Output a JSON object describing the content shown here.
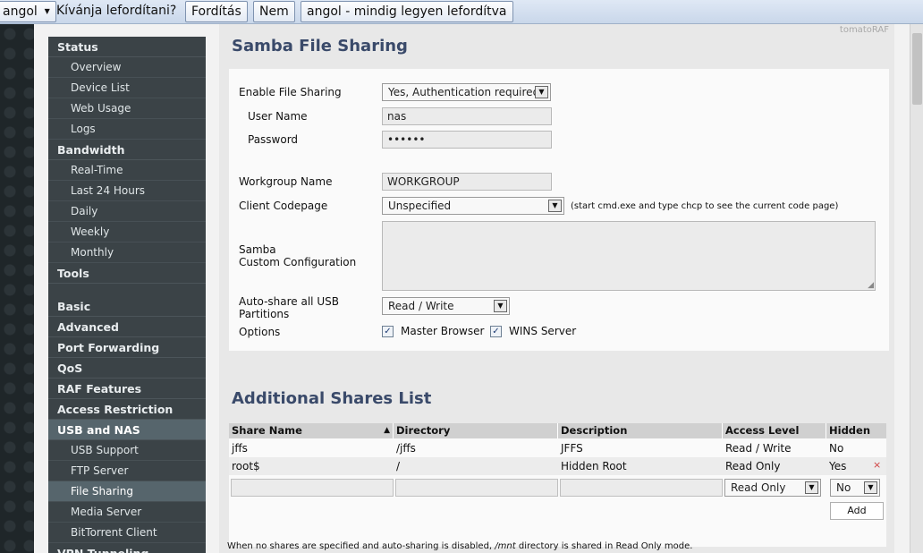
{
  "translate_bar": {
    "language": "angol",
    "question": "Kívánja lefordítani?",
    "translate": "Fordítás",
    "no": "Nem",
    "always": "angol - mindig legyen lefordítva"
  },
  "sidebar": {
    "items": [
      {
        "label": "Status",
        "type": "header"
      },
      {
        "label": "Overview",
        "type": "sub"
      },
      {
        "label": "Device List",
        "type": "sub"
      },
      {
        "label": "Web Usage",
        "type": "sub"
      },
      {
        "label": "Logs",
        "type": "sub"
      },
      {
        "label": "Bandwidth",
        "type": "header"
      },
      {
        "label": "Real-Time",
        "type": "sub"
      },
      {
        "label": "Last 24 Hours",
        "type": "sub"
      },
      {
        "label": "Daily",
        "type": "sub"
      },
      {
        "label": "Weekly",
        "type": "sub"
      },
      {
        "label": "Monthly",
        "type": "sub"
      },
      {
        "label": "Tools",
        "type": "header"
      },
      {
        "label": "Basic",
        "type": "header"
      },
      {
        "label": "Advanced",
        "type": "header"
      },
      {
        "label": "Port Forwarding",
        "type": "header"
      },
      {
        "label": "QoS",
        "type": "header"
      },
      {
        "label": "RAF Features",
        "type": "header"
      },
      {
        "label": "Access Restriction",
        "type": "header"
      },
      {
        "label": "USB and NAS",
        "type": "header"
      },
      {
        "label": "USB Support",
        "type": "sub"
      },
      {
        "label": "FTP Server",
        "type": "sub"
      },
      {
        "label": "File Sharing",
        "type": "sub"
      },
      {
        "label": "Media Server",
        "type": "sub"
      },
      {
        "label": "BitTorrent Client",
        "type": "sub"
      },
      {
        "label": "VPN Tunneling",
        "type": "header"
      }
    ]
  },
  "brand": "tomatoRAF",
  "samba": {
    "title": "Samba File Sharing",
    "enable_label": "Enable File Sharing",
    "enable_value": "Yes, Authentication required",
    "user_label": "User Name",
    "user_value": "nas",
    "pass_label": "Password",
    "pass_value": "••••••",
    "workgroup_label": "Workgroup Name",
    "workgroup_value": "WORKGROUP",
    "codepage_label": "Client Codepage",
    "codepage_value": "Unspecified",
    "codepage_hint": "(start cmd.exe and type chcp to see the current code page)",
    "custom_label_1": "Samba",
    "custom_label_2": "Custom Configuration",
    "autoshare_label_1": "Auto-share all USB",
    "autoshare_label_2": "Partitions",
    "autoshare_value": "Read / Write",
    "options_label": "Options",
    "master_browser": "Master Browser",
    "wins_server": "WINS Server",
    "check_glyph": "✓"
  },
  "shares": {
    "title": "Additional Shares List",
    "sort_indicator": "▲",
    "headers": {
      "name": "Share Name",
      "directory": "Directory",
      "description": "Description",
      "access": "Access Level",
      "hidden": "Hidden"
    },
    "rows": [
      {
        "name": "jffs",
        "directory": "/jffs",
        "description": "JFFS",
        "access": "Read / Write",
        "hidden": "No"
      },
      {
        "name": "root$",
        "directory": "/",
        "description": "Hidden Root",
        "access": "Read Only",
        "hidden": "Yes",
        "delete": "×"
      }
    ],
    "new_access": "Read Only",
    "new_hidden": "No",
    "add": "Add",
    "note_pre": "When no shares are specified and auto-sharing is disabled, ",
    "note_dir": "/mnt",
    "note_post": " directory is shared in Read Only mode."
  }
}
